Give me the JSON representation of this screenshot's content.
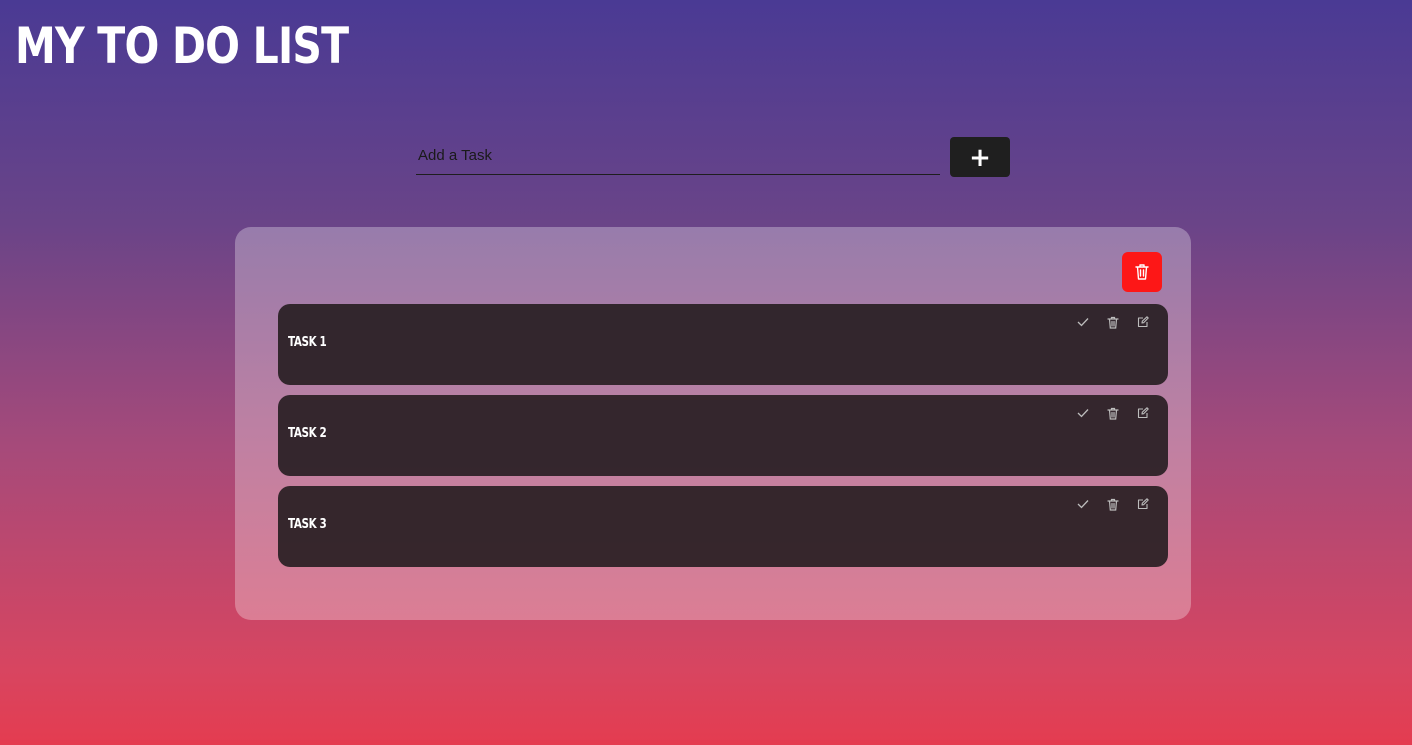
{
  "header": {
    "title": "MY TO DO LIST"
  },
  "add_task": {
    "placeholder": "Add a Task",
    "value": "",
    "button_label": "+"
  },
  "panel": {
    "clear_all_icon": "trash-icon"
  },
  "tasks": [
    {
      "name": "TASK 1",
      "actions": [
        "check-icon",
        "trash-icon",
        "edit-icon"
      ]
    },
    {
      "name": "TASK 2",
      "actions": [
        "check-icon",
        "trash-icon",
        "edit-icon"
      ]
    },
    {
      "name": "TASK 3",
      "actions": [
        "check-icon",
        "trash-icon",
        "edit-icon"
      ]
    }
  ],
  "colors": {
    "delete_all": "#fd1717",
    "add_button": "#1f1f1f",
    "task_card": "#2a1f24",
    "gradient_top": "#4a3a94",
    "gradient_bottom": "#e43c50"
  }
}
